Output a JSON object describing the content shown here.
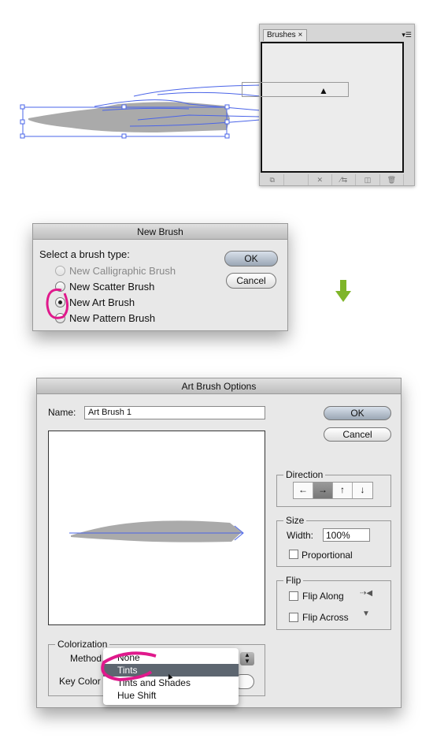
{
  "brushes_panel": {
    "tab_label": "Brushes",
    "tab_close": "×",
    "tools": [
      "⧉",
      "",
      "✕",
      "⁄⇆",
      "◫",
      "🗑"
    ]
  },
  "new_brush": {
    "title": "New Brush",
    "prompt": "Select a brush type:",
    "options": [
      {
        "label": "New Calligraphic Brush",
        "selected": false,
        "disabled": true
      },
      {
        "label": "New Scatter Brush",
        "selected": false,
        "disabled": false
      },
      {
        "label": "New Art Brush",
        "selected": true,
        "disabled": false
      },
      {
        "label": "New Pattern Brush",
        "selected": false,
        "disabled": false
      }
    ],
    "ok": "OK",
    "cancel": "Cancel"
  },
  "art_brush": {
    "title": "Art Brush Options",
    "name_label": "Name:",
    "name_value": "Art Brush 1",
    "ok": "OK",
    "cancel": "Cancel",
    "direction": {
      "label": "Direction",
      "buttons": [
        "←",
        "→",
        "↑",
        "↓"
      ],
      "selected": "→"
    },
    "size": {
      "label": "Size",
      "width_label": "Width:",
      "width_value": "100%",
      "proportional": "Proportional"
    },
    "flip": {
      "label": "Flip",
      "along": "Flip Along",
      "across": "Flip Across"
    },
    "colorization": {
      "label": "Colorization",
      "method_label": "Method",
      "key_color_label": "Key Color",
      "menu": [
        "None",
        "Tints",
        "Tints and Shades",
        "Hue Shift"
      ],
      "highlighted": "Tints"
    }
  },
  "colors": {
    "annotation": "#e0198c",
    "path_blue": "#4a64e8",
    "arrow_green": "#7fb52a"
  }
}
